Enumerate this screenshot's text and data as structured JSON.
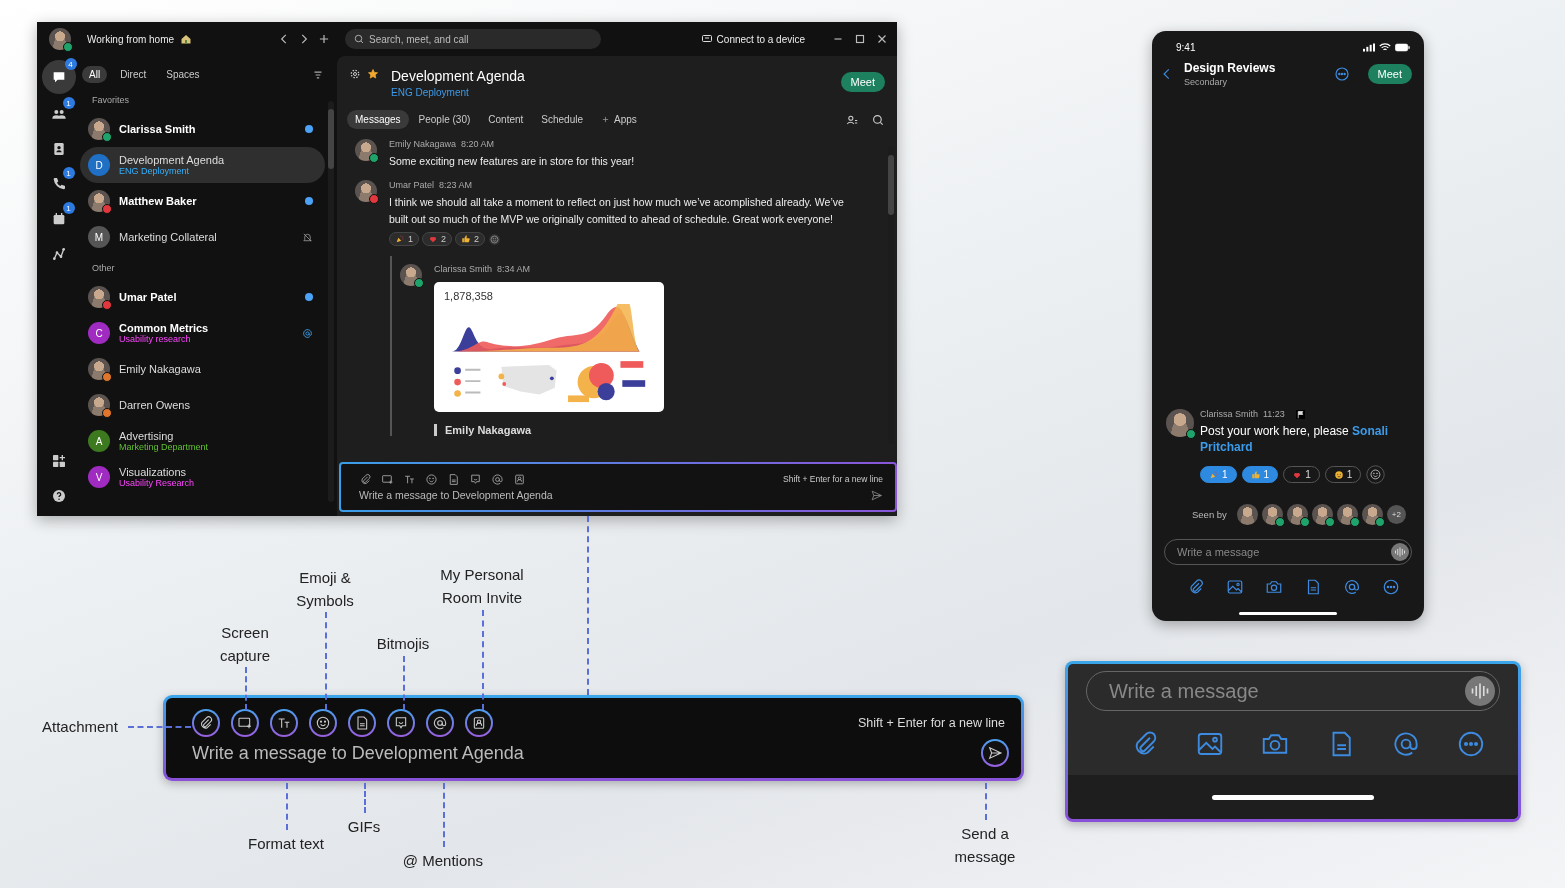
{
  "desktop": {
    "user": {
      "status_text": "Working from home",
      "presence": {
        "color": "#1fa36a"
      }
    },
    "search": {
      "placeholder": "Search, meet, and call"
    },
    "connect": "Connect to a device",
    "rail": [
      {
        "badge": "4",
        "selected": true
      },
      {
        "badge": "1",
        "selected": false
      },
      {
        "selected": false
      },
      {
        "badge": "1",
        "selected": false
      },
      {
        "badge": "1",
        "selected": false
      },
      {
        "selected": false
      }
    ],
    "filters": [
      {
        "label": "All",
        "selected": true
      },
      {
        "label": "Direct",
        "selected": false
      },
      {
        "label": "Spaces",
        "selected": false
      }
    ],
    "sections": [
      {
        "title": "Favorites",
        "items": [
          {
            "name": "Clarissa Smith",
            "avatar": {
              "kind": "photo"
            },
            "presence": {
              "color": "#1fa36a"
            },
            "unread": true,
            "unread_dot": true,
            "muted": false,
            "mention": false,
            "selected": false
          },
          {
            "name": "Development Agenda",
            "subtitle": "ENG Deployment",
            "avatar": {
              "kind": "letter",
              "letter": "D",
              "color": "#1f6fc5"
            },
            "unread": false,
            "unread_dot": false,
            "muted": false,
            "mention": false,
            "selected": true
          },
          {
            "name": "Matthew Baker",
            "avatar": {
              "kind": "photo"
            },
            "presence": {
              "color": "#e0383e"
            },
            "unread": true,
            "unread_dot": true,
            "muted": false,
            "mention": false,
            "selected": false
          },
          {
            "name": "Marketing Collateral",
            "avatar": {
              "kind": "letter",
              "letter": "M",
              "color": "#555555"
            },
            "unread": false,
            "unread_dot": false,
            "muted": true,
            "mention": false,
            "selected": false
          }
        ]
      },
      {
        "title": "Other",
        "items": [
          {
            "name": "Umar Patel",
            "avatar": {
              "kind": "photo"
            },
            "presence": {
              "color": "#e0383e"
            },
            "unread": true,
            "unread_dot": true,
            "muted": false,
            "mention": false,
            "selected": false
          },
          {
            "name": "Common Metrics",
            "subtitle": "Usability research",
            "avatar": {
              "kind": "letter",
              "letter": "C",
              "color": "#a02bc0"
            },
            "unread": true,
            "unread_dot": false,
            "muted": false,
            "mention": true,
            "selected": false
          },
          {
            "name": "Emily Nakagawa",
            "avatar": {
              "kind": "photo"
            },
            "presence": {
              "color": "#e0762b"
            },
            "unread": false,
            "unread_dot": false,
            "muted": false,
            "mention": false,
            "selected": false
          },
          {
            "name": "Darren Owens",
            "avatar": {
              "kind": "photo"
            },
            "presence": {
              "color": "#e0762b"
            },
            "unread": false,
            "unread_dot": false,
            "muted": false,
            "mention": false,
            "selected": false
          },
          {
            "name": "Advertising",
            "subtitle": "Marketing Department",
            "avatar": {
              "kind": "letter",
              "letter": "A",
              "color": "#3d7a1f"
            },
            "unread": false,
            "unread_dot": false,
            "muted": false,
            "mention": false,
            "selected": false
          },
          {
            "name": "Visualizations",
            "subtitle": "Usability Research",
            "avatar": {
              "kind": "letter",
              "letter": "V",
              "color": "#a02bc0"
            },
            "unread": false,
            "unread_dot": false,
            "muted": false,
            "mention": false,
            "selected": false
          }
        ]
      }
    ],
    "space": {
      "title": "Development Agenda",
      "subtitle": "ENG Deployment",
      "favorite": true,
      "meet": "Meet"
    },
    "tabs": [
      {
        "label": "Messages",
        "selected": true,
        "kind": "tab"
      },
      {
        "label": "People (30)",
        "selected": false,
        "kind": "tab"
      },
      {
        "label": "Content",
        "selected": false,
        "kind": "tab"
      },
      {
        "label": "Schedule",
        "selected": false,
        "kind": "tab"
      },
      {
        "label": "Apps",
        "selected": false,
        "kind": "add"
      }
    ],
    "messages": [
      {
        "author": "Emily Nakagawa",
        "time": "8:20 AM",
        "presence": {
          "color": "#1fa36a"
        },
        "text": "Some exciting new features are in store for this year!"
      },
      {
        "author": "Umar Patel",
        "time": "8:23 AM",
        "presence": {
          "color": "#e0383e"
        },
        "text": "I think we should all take a moment to reflect on just how much we’ve acomplished already. We’ve built out so much of the MVP we originally comitted to ahead of schedule. Great work everyone!",
        "reactions": [
          {
            "kind": "party",
            "count": "1"
          },
          {
            "kind": "heart",
            "count": "2"
          },
          {
            "kind": "thumbs",
            "count": "2"
          }
        ]
      }
    ],
    "thread": {
      "author": "Clarissa Smith",
      "time": "8:34 AM",
      "presence": {
        "color": "#1fa36a"
      },
      "figure": "1,878,358",
      "next_author": "Emily Nakagawa"
    },
    "composer": {
      "placeholder": "Write a message to Development Agenda",
      "hint": "Shift + Enter for a new line"
    }
  },
  "phone": {
    "time": "9:41",
    "title": "Design Reviews",
    "subtitle": "Secondary",
    "meet": "Meet",
    "message": {
      "author": "Clarissa Smith",
      "time": "11:23",
      "presence": {
        "color": "#1fa36a"
      },
      "text": "Post your work here, please **Sonali Pritchard**",
      "reactions": [
        {
          "kind": "party",
          "count": "1",
          "selected": true
        },
        {
          "kind": "thumbs",
          "count": "1",
          "selected": true
        },
        {
          "kind": "heart",
          "count": "1",
          "selected": false
        },
        {
          "kind": "smile",
          "count": "1",
          "selected": false
        }
      ]
    },
    "seen_by": {
      "label": "Seen by",
      "avatars": [
        {
          "online": false
        },
        {
          "online": true
        },
        {
          "online": true
        },
        {
          "online": true
        },
        {
          "online": true
        },
        {
          "online": true
        }
      ],
      "more": "+2"
    },
    "composer": {
      "placeholder": "Write a message"
    }
  },
  "callout": {
    "placeholder": "Write a message to Development Agenda",
    "hint": "Shift + Enter for a new line",
    "annotations": [
      {
        "label": "Emoji & Symbols",
        "kind": "above"
      },
      {
        "label": "My Personal Room Invite",
        "kind": "above"
      },
      {
        "label": "Screen capture",
        "kind": "above"
      },
      {
        "label": "Bitmojis",
        "kind": "above"
      },
      {
        "label": "Attachment",
        "kind": "left"
      },
      {
        "label": "Format text",
        "kind": "below"
      },
      {
        "label": "GIFs",
        "kind": "below"
      },
      {
        "label": "@ Mentions",
        "kind": "below"
      },
      {
        "label": "Send a message",
        "kind": "below"
      }
    ]
  },
  "phone_zoom": {
    "placeholder": "Write a message"
  }
}
